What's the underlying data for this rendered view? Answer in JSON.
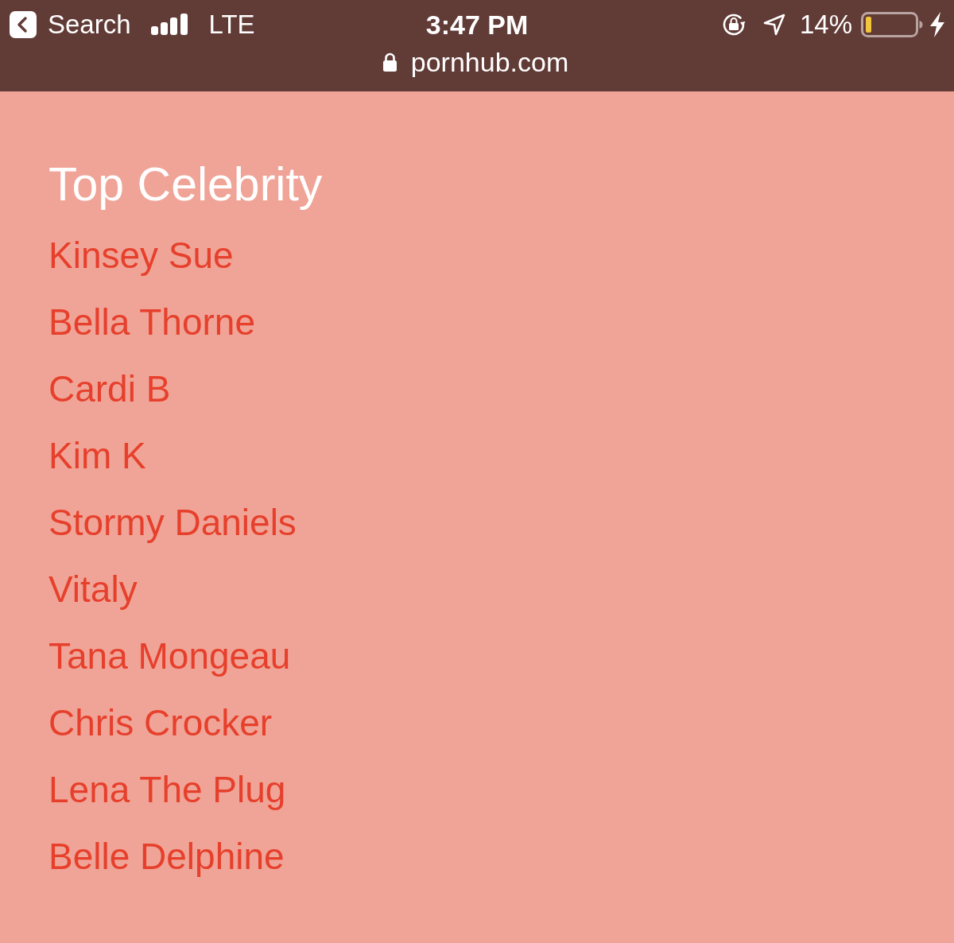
{
  "status_bar": {
    "back_label": "Search",
    "network": "LTE",
    "time": "3:47 PM",
    "battery_percent": "14%"
  },
  "address_bar": {
    "url": "pornhub.com"
  },
  "section": {
    "title": "Top Celebrity",
    "links": [
      "Kinsey Sue",
      "Bella Thorne",
      "Cardi B",
      "Kim K",
      "Stormy Daniels",
      "Vitaly",
      "Tana Mongeau",
      "Chris Crocker",
      "Lena The Plug",
      "Belle Delphine"
    ]
  }
}
